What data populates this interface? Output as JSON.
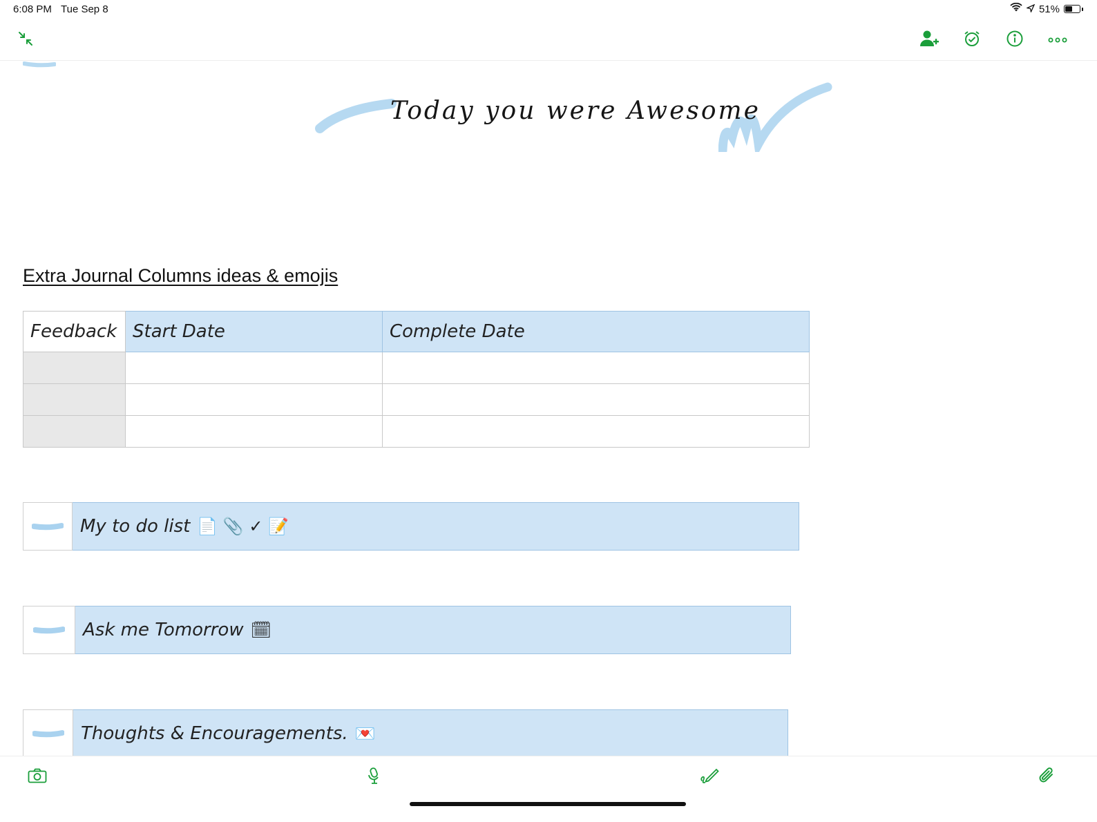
{
  "status_bar": {
    "time": "6:08 PM",
    "date": "Tue Sep 8",
    "battery_text": "51%",
    "battery_level": 0.51
  },
  "toolbar": {
    "accent_color": "#1a9e3a",
    "icons": [
      "collapse-icon",
      "add-person-icon",
      "reminder-alarm-icon",
      "info-icon",
      "more-icon"
    ]
  },
  "note": {
    "banner_text": "Today you were Awesome",
    "section_heading": "Extra Journal Columns ideas & emojis",
    "table": {
      "headers": [
        "Feedback",
        "Start Date",
        "Complete Date"
      ],
      "rows": [
        [
          "",
          "",
          ""
        ],
        [
          "",
          "",
          ""
        ],
        [
          "",
          "",
          ""
        ]
      ]
    },
    "callouts": [
      {
        "text": "My to do list",
        "emojis": "📄 📎 ✓ 📝"
      },
      {
        "text": "Ask me Tomorrow",
        "emojis": "🗓"
      },
      {
        "text": "Thoughts & Encouragements.",
        "emojis": "💌"
      }
    ],
    "highlight_color": "#cfe4f6"
  },
  "bottom_toolbar": {
    "icons": [
      "camera-icon",
      "microphone-icon",
      "handwriting-pen-icon",
      "paperclip-icon"
    ]
  }
}
